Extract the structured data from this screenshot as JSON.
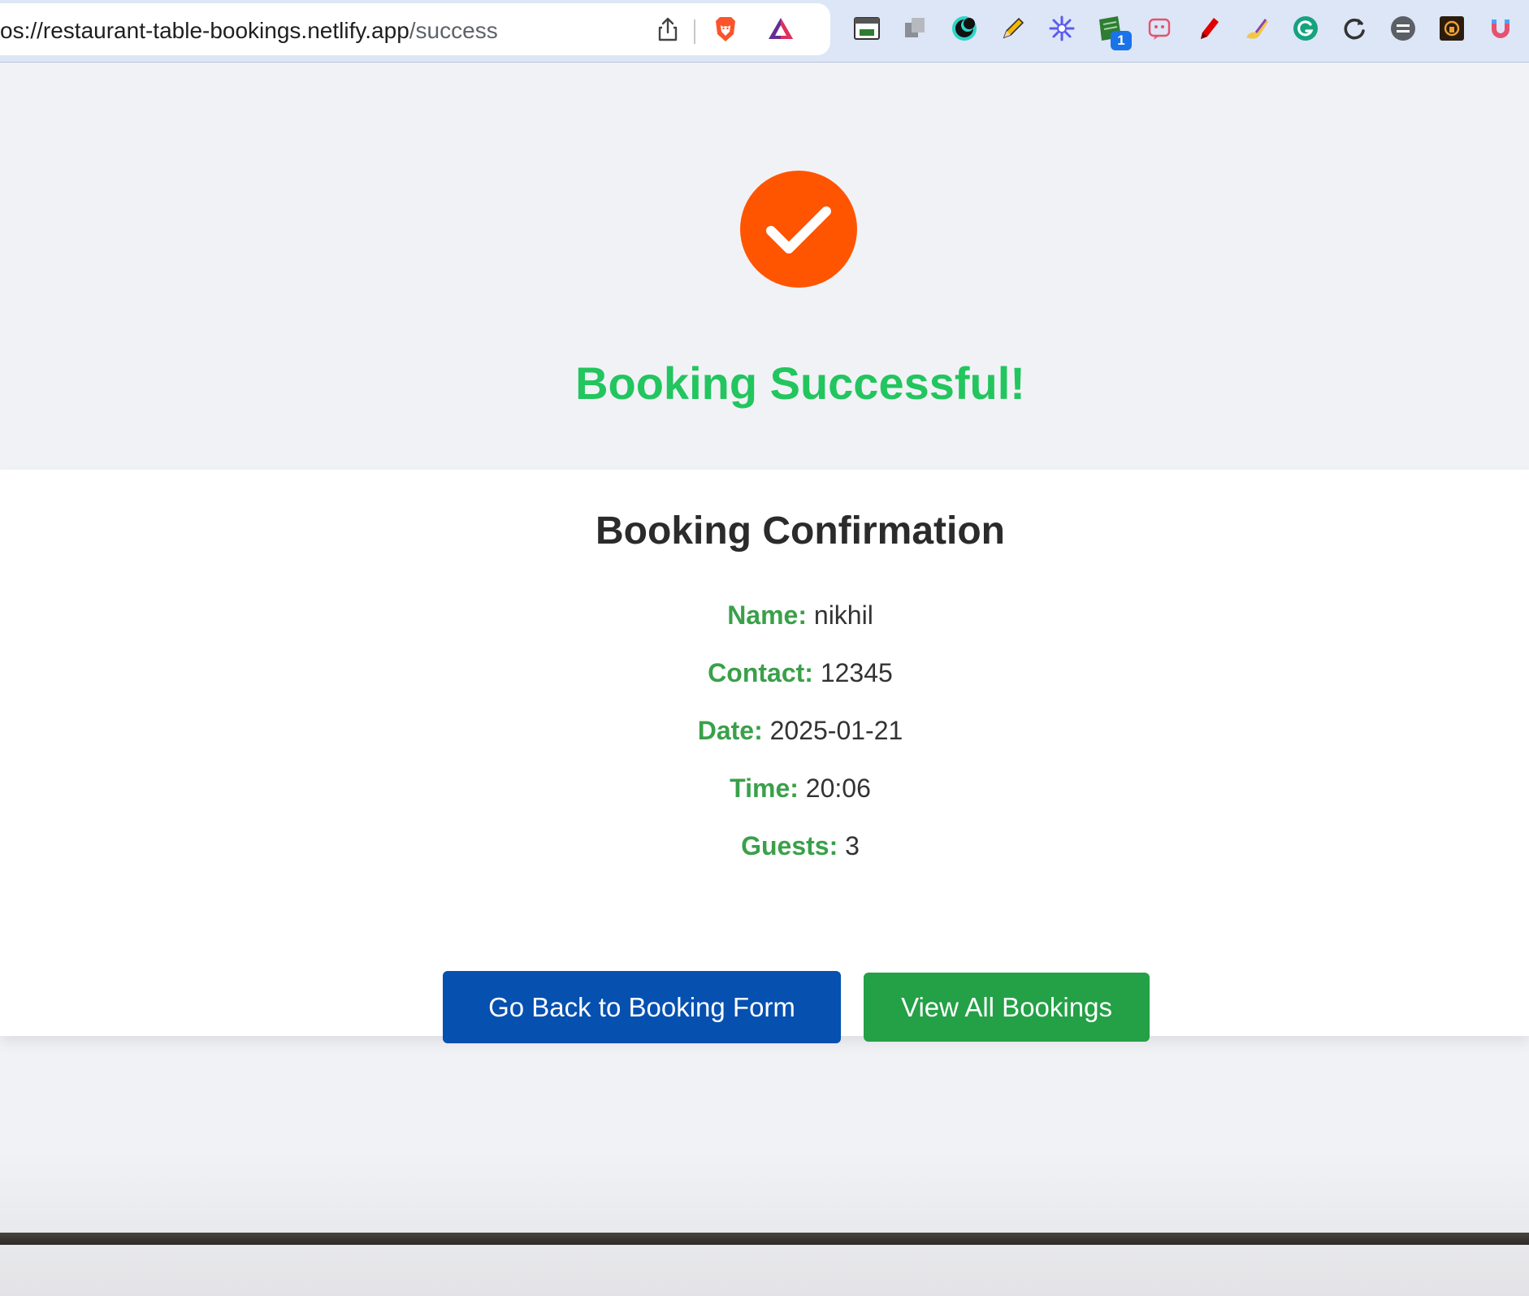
{
  "browser": {
    "url_host": "os://restaurant-table-bookings.netlify.app",
    "url_path": "/success",
    "extension_badge": "1",
    "icons": [
      "share-icon",
      "brave-shield-icon",
      "brave-rewards-icon",
      "extension-icons"
    ]
  },
  "page": {
    "success_title": "Booking Successful!",
    "card_title": "Booking Confirmation",
    "details": [
      {
        "label": "Name:",
        "value": "nikhil"
      },
      {
        "label": "Contact:",
        "value": "12345"
      },
      {
        "label": "Date:",
        "value": "2025-01-21"
      },
      {
        "label": "Time:",
        "value": "20:06"
      },
      {
        "label": "Guests:",
        "value": "3"
      }
    ],
    "buttons": {
      "back": "Go Back to Booking Form",
      "view_all": "View All Bookings"
    }
  },
  "colors": {
    "success_circle": "#ff5500",
    "success_title": "#22c55e",
    "label_green": "#3aa04a",
    "back_button": "#0650b0",
    "view_button": "#24a046"
  }
}
